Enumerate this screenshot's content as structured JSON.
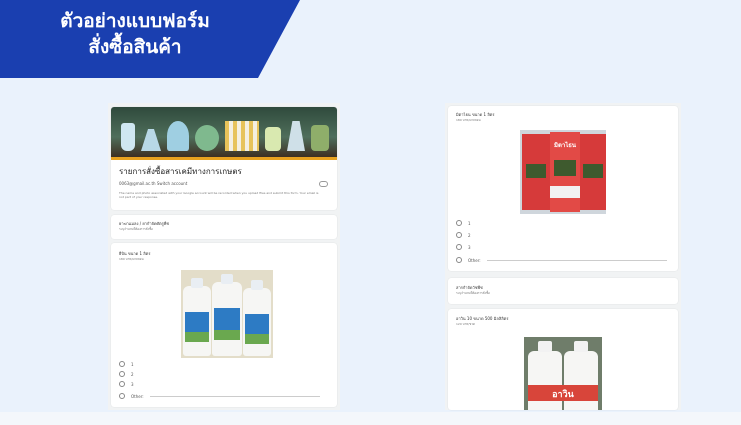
{
  "banner": {
    "line1": "ตัวอย่างแบบฟอร์ม",
    "line2": "สั่งซื้อสินค้า",
    "color": "#1a3fb0"
  },
  "left_form": {
    "title": "รายการสั่งซื้อสารเคมีทางการเกษตร",
    "account": "0063@gmail.ac.th Switch account",
    "notice": "The name and photo associated with your Google account will be recorded when you upload files and submit this form. Your email is not part of your response.",
    "section1_title": "ยาฆ่าแมลง / ยากำจัดศัตรูพืช",
    "section1_sub": "ระบุจำนวนที่ต้องการสั่งซื้อ",
    "q1_title": "ยีบิน ขนาด 1 ลิตร",
    "q1_price": "180 บาท/แกลลอน",
    "q1_options": [
      "1",
      "2",
      "3",
      "Other:"
    ]
  },
  "right_form": {
    "q2_title": "มิตาไธน ขนาด 1 ลิตร",
    "q2_price": "180 บาท/แกลลอน",
    "product_label": "มิตาไธน",
    "q2_options": [
      "1",
      "2",
      "3",
      "Other:"
    ],
    "section2_title": "สารกำจัดวัชพืช",
    "section2_sub": "ระบุจำนวนที่ต้องการสั่งซื้อ",
    "q3_title": "อาวิน 10 ขนาด 500 มิลลิลิตร",
    "q3_price": "120 บาท/ขวด",
    "q3_bottle_label": "อาวิน"
  }
}
